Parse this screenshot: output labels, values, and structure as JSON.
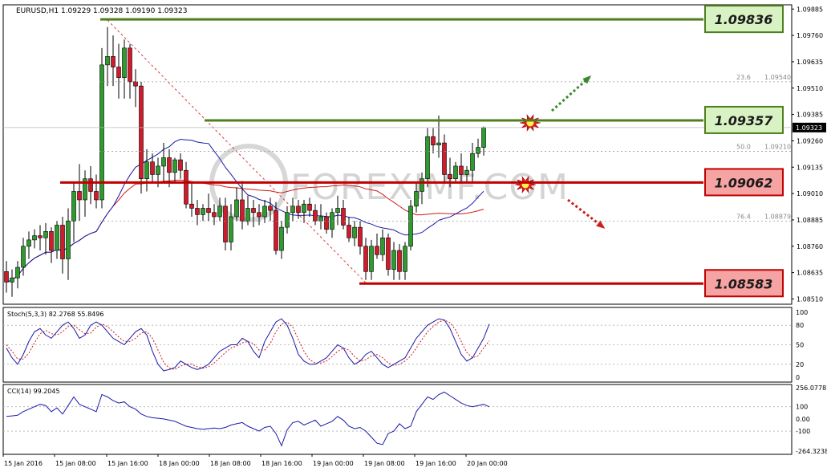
{
  "header": {
    "symbol": "EURUSD,H1",
    "ohlc": "1.09229 1.09328 1.09190 1.09323"
  },
  "watermark": "FOREXIMF.COM",
  "price_axis": [
    "1.09885",
    "1.09760",
    "1.09635",
    "1.09510",
    "1.09385",
    "1.09260",
    "1.09135",
    "1.09010",
    "1.08885",
    "1.08760",
    "1.08635",
    "1.08510"
  ],
  "current_price": "1.09323",
  "levels": [
    {
      "label": "1.09836",
      "price": 1.09836,
      "color": "#4f7f1f",
      "box_bg": "#d9f2c4"
    },
    {
      "label": "1.09357",
      "price": 1.09357,
      "color": "#4f7f1f",
      "box_bg": "#d9f2c4"
    },
    {
      "label": "1.09062",
      "price": 1.09062,
      "color": "#c00000",
      "box_bg": "#f5a3a3"
    },
    {
      "label": "1.08583",
      "price": 1.08583,
      "color": "#c00000",
      "box_bg": "#f5a3a3"
    }
  ],
  "fib_levels": [
    {
      "ratio": "23.6",
      "value": "1.09540",
      "price": 1.0954
    },
    {
      "ratio": "50.0",
      "value": "1.09210",
      "price": 1.0921
    },
    {
      "ratio": "76.4",
      "value": "1.08879",
      "price": 1.08879
    }
  ],
  "stoch": {
    "label": "Stoch(5,3,3) 82.2768 55.8496",
    "scale": [
      "100",
      "80",
      "50",
      "20",
      "0"
    ]
  },
  "cci": {
    "label": "CCI(14) 99.2045",
    "scale": [
      "256.0778",
      "100",
      "0.00",
      "-100",
      "-264.3238"
    ]
  },
  "time_axis": [
    "15 Jan 2016",
    "15 Jan 08:00",
    "15 Jan 16:00",
    "18 Jan 00:00",
    "18 Jan 08:00",
    "18 Jan 16:00",
    "19 Jan 00:00",
    "19 Jan 08:00",
    "19 Jan 16:00",
    "20 Jan 00:00"
  ],
  "colors": {
    "bull": "#2e9b2e",
    "bear": "#d11a2a",
    "ma_fast": "#1a1aa6",
    "ma_slow": "#d11a1a",
    "stoch_main": "#1a1aa6",
    "stoch_signal": "#d11a1a",
    "cci": "#1a1aa6"
  },
  "chart_data": {
    "type": "candlestick",
    "symbol": "EURUSD",
    "timeframe": "H1",
    "ylim": [
      1.08485,
      1.09905
    ],
    "candles": [
      {
        "o": 1.0864,
        "h": 1.0869,
        "l": 1.0854,
        "c": 1.0859
      },
      {
        "o": 1.0859,
        "h": 1.0865,
        "l": 1.0852,
        "c": 1.0861
      },
      {
        "o": 1.0861,
        "h": 1.0869,
        "l": 1.0856,
        "c": 1.0866
      },
      {
        "o": 1.0866,
        "h": 1.088,
        "l": 1.0862,
        "c": 1.0876
      },
      {
        "o": 1.0876,
        "h": 1.0883,
        "l": 1.087,
        "c": 1.0879
      },
      {
        "o": 1.0879,
        "h": 1.0884,
        "l": 1.0875,
        "c": 1.0881
      },
      {
        "o": 1.0881,
        "h": 1.0886,
        "l": 1.0874,
        "c": 1.088
      },
      {
        "o": 1.088,
        "h": 1.0887,
        "l": 1.0872,
        "c": 1.0883
      },
      {
        "o": 1.0883,
        "h": 1.0885,
        "l": 1.0868,
        "c": 1.0874
      },
      {
        "o": 1.0874,
        "h": 1.0888,
        "l": 1.087,
        "c": 1.0886
      },
      {
        "o": 1.0886,
        "h": 1.089,
        "l": 1.0863,
        "c": 1.087
      },
      {
        "o": 1.087,
        "h": 1.0894,
        "l": 1.086,
        "c": 1.0888
      },
      {
        "o": 1.0888,
        "h": 1.0906,
        "l": 1.0878,
        "c": 1.0902
      },
      {
        "o": 1.0902,
        "h": 1.0915,
        "l": 1.0888,
        "c": 1.0898
      },
      {
        "o": 1.0898,
        "h": 1.0912,
        "l": 1.089,
        "c": 1.0908
      },
      {
        "o": 1.0908,
        "h": 1.0914,
        "l": 1.0896,
        "c": 1.0902
      },
      {
        "o": 1.0902,
        "h": 1.091,
        "l": 1.0894,
        "c": 1.0898
      },
      {
        "o": 1.0898,
        "h": 1.097,
        "l": 1.0894,
        "c": 1.0962
      },
      {
        "o": 1.0962,
        "h": 1.098,
        "l": 1.0952,
        "c": 1.0966
      },
      {
        "o": 1.0966,
        "h": 1.0976,
        "l": 1.0952,
        "c": 1.0961
      },
      {
        "o": 1.0961,
        "h": 1.0972,
        "l": 1.0946,
        "c": 1.0956
      },
      {
        "o": 1.0956,
        "h": 1.0974,
        "l": 1.0946,
        "c": 1.097
      },
      {
        "o": 1.097,
        "h": 1.0972,
        "l": 1.0946,
        "c": 1.0954
      },
      {
        "o": 1.0954,
        "h": 1.096,
        "l": 1.0942,
        "c": 1.0952
      },
      {
        "o": 1.0952,
        "h": 1.0954,
        "l": 1.0901,
        "c": 1.0908
      },
      {
        "o": 1.0908,
        "h": 1.0922,
        "l": 1.0902,
        "c": 1.0916
      },
      {
        "o": 1.0916,
        "h": 1.092,
        "l": 1.0906,
        "c": 1.091
      },
      {
        "o": 1.091,
        "h": 1.0918,
        "l": 1.0904,
        "c": 1.0914
      },
      {
        "o": 1.0914,
        "h": 1.0925,
        "l": 1.0906,
        "c": 1.0918
      },
      {
        "o": 1.0918,
        "h": 1.0922,
        "l": 1.0904,
        "c": 1.0911
      },
      {
        "o": 1.0911,
        "h": 1.0918,
        "l": 1.0906,
        "c": 1.0917
      },
      {
        "o": 1.0917,
        "h": 1.092,
        "l": 1.0908,
        "c": 1.0912
      },
      {
        "o": 1.0912,
        "h": 1.0916,
        "l": 1.0894,
        "c": 1.0896
      },
      {
        "o": 1.0896,
        "h": 1.0906,
        "l": 1.089,
        "c": 1.0894
      },
      {
        "o": 1.0894,
        "h": 1.0898,
        "l": 1.0886,
        "c": 1.0891
      },
      {
        "o": 1.0891,
        "h": 1.0896,
        "l": 1.0888,
        "c": 1.0894
      },
      {
        "o": 1.0894,
        "h": 1.0901,
        "l": 1.0888,
        "c": 1.0892
      },
      {
        "o": 1.0892,
        "h": 1.0896,
        "l": 1.0886,
        "c": 1.089
      },
      {
        "o": 1.089,
        "h": 1.0899,
        "l": 1.0888,
        "c": 1.0895
      },
      {
        "o": 1.0895,
        "h": 1.0899,
        "l": 1.0874,
        "c": 1.0878
      },
      {
        "o": 1.0878,
        "h": 1.0896,
        "l": 1.0874,
        "c": 1.089
      },
      {
        "o": 1.089,
        "h": 1.0904,
        "l": 1.0888,
        "c": 1.0898
      },
      {
        "o": 1.0898,
        "h": 1.0907,
        "l": 1.0884,
        "c": 1.0888
      },
      {
        "o": 1.0888,
        "h": 1.09,
        "l": 1.0886,
        "c": 1.0894
      },
      {
        "o": 1.0894,
        "h": 1.0898,
        "l": 1.0885,
        "c": 1.0892
      },
      {
        "o": 1.0892,
        "h": 1.0896,
        "l": 1.0886,
        "c": 1.089
      },
      {
        "o": 1.089,
        "h": 1.0898,
        "l": 1.0887,
        "c": 1.0895
      },
      {
        "o": 1.0895,
        "h": 1.0899,
        "l": 1.0888,
        "c": 1.0893
      },
      {
        "o": 1.0893,
        "h": 1.0897,
        "l": 1.0872,
        "c": 1.0874
      },
      {
        "o": 1.0874,
        "h": 1.0888,
        "l": 1.087,
        "c": 1.0885
      },
      {
        "o": 1.0885,
        "h": 1.0895,
        "l": 1.0882,
        "c": 1.0892
      },
      {
        "o": 1.0892,
        "h": 1.0899,
        "l": 1.0888,
        "c": 1.0895
      },
      {
        "o": 1.0895,
        "h": 1.0898,
        "l": 1.0889,
        "c": 1.0892
      },
      {
        "o": 1.0892,
        "h": 1.0898,
        "l": 1.0887,
        "c": 1.0896
      },
      {
        "o": 1.0896,
        "h": 1.0899,
        "l": 1.089,
        "c": 1.0893
      },
      {
        "o": 1.0893,
        "h": 1.0896,
        "l": 1.0886,
        "c": 1.0888
      },
      {
        "o": 1.0888,
        "h": 1.0896,
        "l": 1.0884,
        "c": 1.089
      },
      {
        "o": 1.089,
        "h": 1.0892,
        "l": 1.0882,
        "c": 1.0884
      },
      {
        "o": 1.0884,
        "h": 1.0894,
        "l": 1.088,
        "c": 1.0892
      },
      {
        "o": 1.0892,
        "h": 1.09,
        "l": 1.0886,
        "c": 1.0894
      },
      {
        "o": 1.0894,
        "h": 1.0898,
        "l": 1.0884,
        "c": 1.0886
      },
      {
        "o": 1.0886,
        "h": 1.089,
        "l": 1.0878,
        "c": 1.088
      },
      {
        "o": 1.088,
        "h": 1.0888,
        "l": 1.0876,
        "c": 1.0885
      },
      {
        "o": 1.0885,
        "h": 1.0888,
        "l": 1.0872,
        "c": 1.0876
      },
      {
        "o": 1.0876,
        "h": 1.088,
        "l": 1.086,
        "c": 1.0864
      },
      {
        "o": 1.0864,
        "h": 1.0879,
        "l": 1.086,
        "c": 1.0876
      },
      {
        "o": 1.0876,
        "h": 1.0882,
        "l": 1.087,
        "c": 1.0872
      },
      {
        "o": 1.0872,
        "h": 1.0884,
        "l": 1.0869,
        "c": 1.088
      },
      {
        "o": 1.088,
        "h": 1.0882,
        "l": 1.0862,
        "c": 1.0865
      },
      {
        "o": 1.0865,
        "h": 1.0878,
        "l": 1.086,
        "c": 1.0874
      },
      {
        "o": 1.0874,
        "h": 1.0877,
        "l": 1.086,
        "c": 1.0864
      },
      {
        "o": 1.0864,
        "h": 1.0878,
        "l": 1.086,
        "c": 1.0876
      },
      {
        "o": 1.0876,
        "h": 1.0898,
        "l": 1.0874,
        "c": 1.0895
      },
      {
        "o": 1.0895,
        "h": 1.0906,
        "l": 1.0892,
        "c": 1.0902
      },
      {
        "o": 1.0902,
        "h": 1.0911,
        "l": 1.0896,
        "c": 1.0908
      },
      {
        "o": 1.0908,
        "h": 1.0932,
        "l": 1.0904,
        "c": 1.0928
      },
      {
        "o": 1.0928,
        "h": 1.0932,
        "l": 1.092,
        "c": 1.0924
      },
      {
        "o": 1.0924,
        "h": 1.0938,
        "l": 1.0918,
        "c": 1.0925
      },
      {
        "o": 1.0925,
        "h": 1.0929,
        "l": 1.0906,
        "c": 1.091
      },
      {
        "o": 1.091,
        "h": 1.0918,
        "l": 1.0904,
        "c": 1.0908
      },
      {
        "o": 1.0908,
        "h": 1.0916,
        "l": 1.0906,
        "c": 1.0914
      },
      {
        "o": 1.0914,
        "h": 1.092,
        "l": 1.0906,
        "c": 1.091
      },
      {
        "o": 1.091,
        "h": 1.0914,
        "l": 1.0906,
        "c": 1.0912
      },
      {
        "o": 1.0912,
        "h": 1.0925,
        "l": 1.0906,
        "c": 1.092
      },
      {
        "o": 1.092,
        "h": 1.0927,
        "l": 1.0918,
        "c": 1.09229
      },
      {
        "o": 1.09229,
        "h": 1.09328,
        "l": 1.0919,
        "c": 1.09323
      }
    ],
    "stoch_ylim": [
      0,
      100
    ],
    "stoch_main": [
      45,
      30,
      20,
      35,
      55,
      70,
      75,
      65,
      60,
      70,
      80,
      85,
      75,
      60,
      65,
      80,
      85,
      80,
      70,
      60,
      55,
      50,
      60,
      70,
      75,
      65,
      40,
      20,
      10,
      12,
      15,
      25,
      20,
      15,
      12,
      15,
      20,
      30,
      40,
      45,
      50,
      50,
      60,
      55,
      40,
      30,
      55,
      70,
      85,
      90,
      80,
      60,
      35,
      25,
      20,
      20,
      25,
      30,
      40,
      50,
      45,
      30,
      20,
      25,
      35,
      40,
      30,
      20,
      15,
      20,
      25,
      30,
      45,
      60,
      70,
      80,
      85,
      90,
      88,
      75,
      55,
      35,
      25,
      30,
      45,
      60,
      82
    ],
    "stoch_signal": [
      50,
      40,
      28,
      28,
      37,
      53,
      67,
      72,
      67,
      65,
      70,
      78,
      80,
      73,
      67,
      68,
      77,
      82,
      78,
      70,
      62,
      55,
      55,
      60,
      68,
      70,
      60,
      42,
      23,
      14,
      12,
      17,
      20,
      20,
      16,
      14,
      16,
      22,
      30,
      38,
      45,
      48,
      53,
      55,
      52,
      42,
      42,
      52,
      70,
      82,
      85,
      77,
      58,
      40,
      27,
      22,
      22,
      25,
      32,
      40,
      45,
      42,
      32,
      25,
      27,
      33,
      35,
      30,
      22,
      18,
      20,
      25,
      33,
      45,
      58,
      70,
      78,
      85,
      88,
      84,
      73,
      55,
      38,
      30,
      33,
      45,
      56
    ],
    "cci_ylim": [
      -264.3238,
      256.0778
    ],
    "cci": [
      20,
      25,
      30,
      60,
      80,
      100,
      120,
      110,
      60,
      90,
      40,
      110,
      180,
      120,
      100,
      80,
      60,
      200,
      180,
      150,
      130,
      140,
      100,
      80,
      40,
      20,
      10,
      5,
      0,
      -10,
      -20,
      -40,
      -60,
      -70,
      -80,
      -85,
      -80,
      -75,
      -80,
      -70,
      -50,
      -40,
      -30,
      -60,
      -80,
      -100,
      -70,
      -60,
      -120,
      -220,
      -90,
      -30,
      -20,
      -50,
      -30,
      -10,
      -60,
      -40,
      -20,
      20,
      -10,
      -60,
      -80,
      -70,
      -100,
      -150,
      -200,
      -210,
      -120,
      -100,
      -40,
      -80,
      -60,
      60,
      120,
      180,
      160,
      200,
      220,
      190,
      160,
      130,
      110,
      100,
      110,
      120,
      99
    ]
  }
}
